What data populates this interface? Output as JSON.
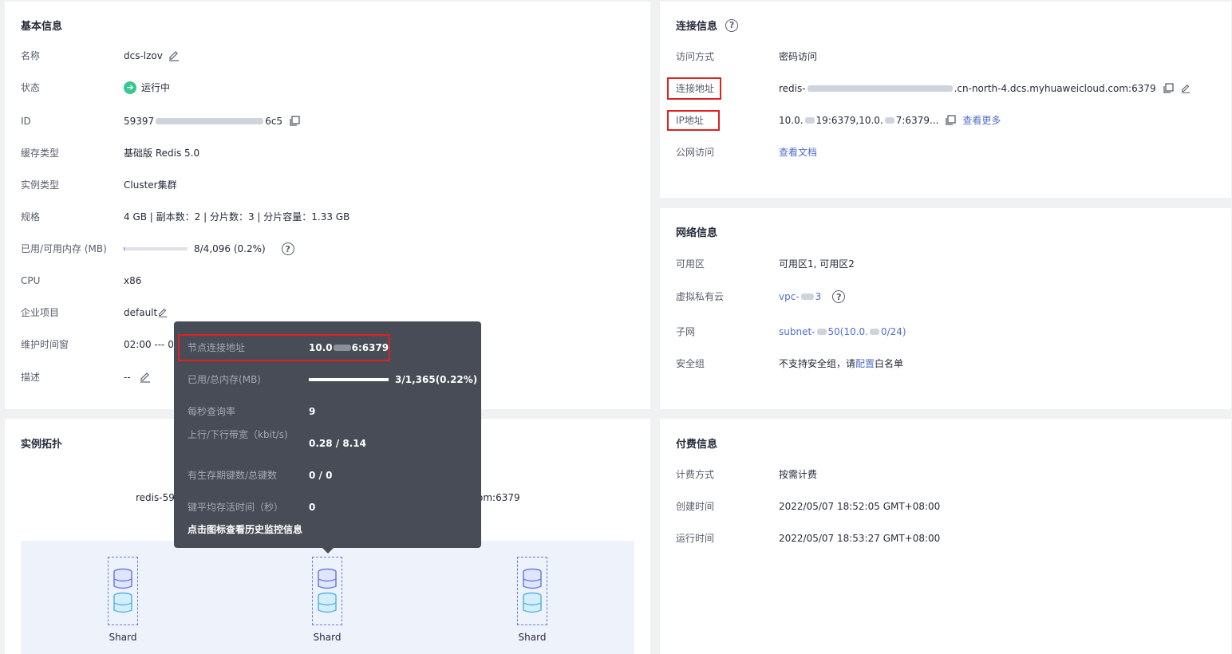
{
  "basic": {
    "title": "基本信息",
    "name_label": "名称",
    "name_value": "dcs-lzov",
    "status_label": "状态",
    "status_value": "运行中",
    "id_label": "ID",
    "id_prefix": "59397",
    "id_suffix": "6c5",
    "cache_type_label": "缓存类型",
    "cache_type_value": "基础版 Redis 5.0",
    "instance_type_label": "实例类型",
    "instance_type_value": "Cluster集群",
    "spec_label": "规格",
    "spec_value": "4 GB | 副本数：2 | 分片数：3 | 分片容量：1.33 GB",
    "memory_label": "已用/可用内存 (MB)",
    "memory_value": "8/4,096 (0.2%)",
    "memory_fraction": 0.002,
    "cpu_label": "CPU",
    "cpu_value": "x86",
    "project_label": "企业项目",
    "project_value": "default",
    "maintenance_label": "维护时间窗",
    "maintenance_value": "02:00 --- 06",
    "desc_label": "描述",
    "desc_value": "--"
  },
  "connection": {
    "title": "连接信息",
    "access_label": "访问方式",
    "access_value": "密码访问",
    "address_label": "连接地址",
    "address_prefix": "redis-",
    "address_suffix": ".cn-north-4.dcs.myhuaweicloud.com:6379",
    "ip_label": "IP地址",
    "ip_part1": "10.0.",
    "ip_part2": "19:6379,10.0.",
    "ip_part3": "7:6379...",
    "view_more": "查看更多",
    "public_label": "公网访问",
    "public_value": "查看文档"
  },
  "network": {
    "title": "网络信息",
    "az_label": "可用区",
    "az_value": "可用区1, 可用区2",
    "vpc_label": "虚拟私有云",
    "vpc_prefix": "vpc-",
    "vpc_suffix": "3",
    "subnet_label": "子网",
    "subnet_prefix": "subnet-",
    "subnet_mid": "50(10.0.",
    "subnet_suffix": "0/24)",
    "sg_label": "安全组",
    "sg_text_before": "不支持安全组，请",
    "sg_link": "配置",
    "sg_text_after": "白名单"
  },
  "topology": {
    "title": "实例拓扑",
    "address_left": "redis-593",
    "address_right": "om:6379",
    "shards": [
      {
        "label": "Shard"
      },
      {
        "label": "Shard"
      },
      {
        "label": "Shard"
      }
    ]
  },
  "tooltip": {
    "node_addr_label": "节点连接地址",
    "node_addr_prefix": "10.0",
    "node_addr_suffix": "6:6379",
    "mem_label": "已用/总内存(MB)",
    "mem_value": "3/1,365(0.22%)",
    "qps_label": "每秒查询率",
    "qps_value": "9",
    "bw_label": "上行/下行带宽（kbit/s)",
    "bw_value": "0.28 / 8.14",
    "keys_label": "有生存期键数/总键数",
    "keys_value": "0 / 0",
    "ttl_label": "键平均存活时间（秒）",
    "ttl_value": "0",
    "footer": "点击图标查看历史监控信息"
  },
  "billing": {
    "title": "付费信息",
    "mode_label": "计费方式",
    "mode_value": "按需计费",
    "created_label": "创建时间",
    "created_value": "2022/05/07 18:52:05 GMT+08:00",
    "run_label": "运行时间",
    "run_value": "2022/05/07 18:53:27 GMT+08:00"
  },
  "colors": {
    "link": "#526ecc",
    "status_green": "#38c890",
    "highlight_red": "#e02020",
    "tooltip_bg": "#474c57"
  },
  "icons": [
    "edit-icon",
    "copy-icon",
    "help-icon",
    "status-running-icon",
    "database-icon"
  ]
}
